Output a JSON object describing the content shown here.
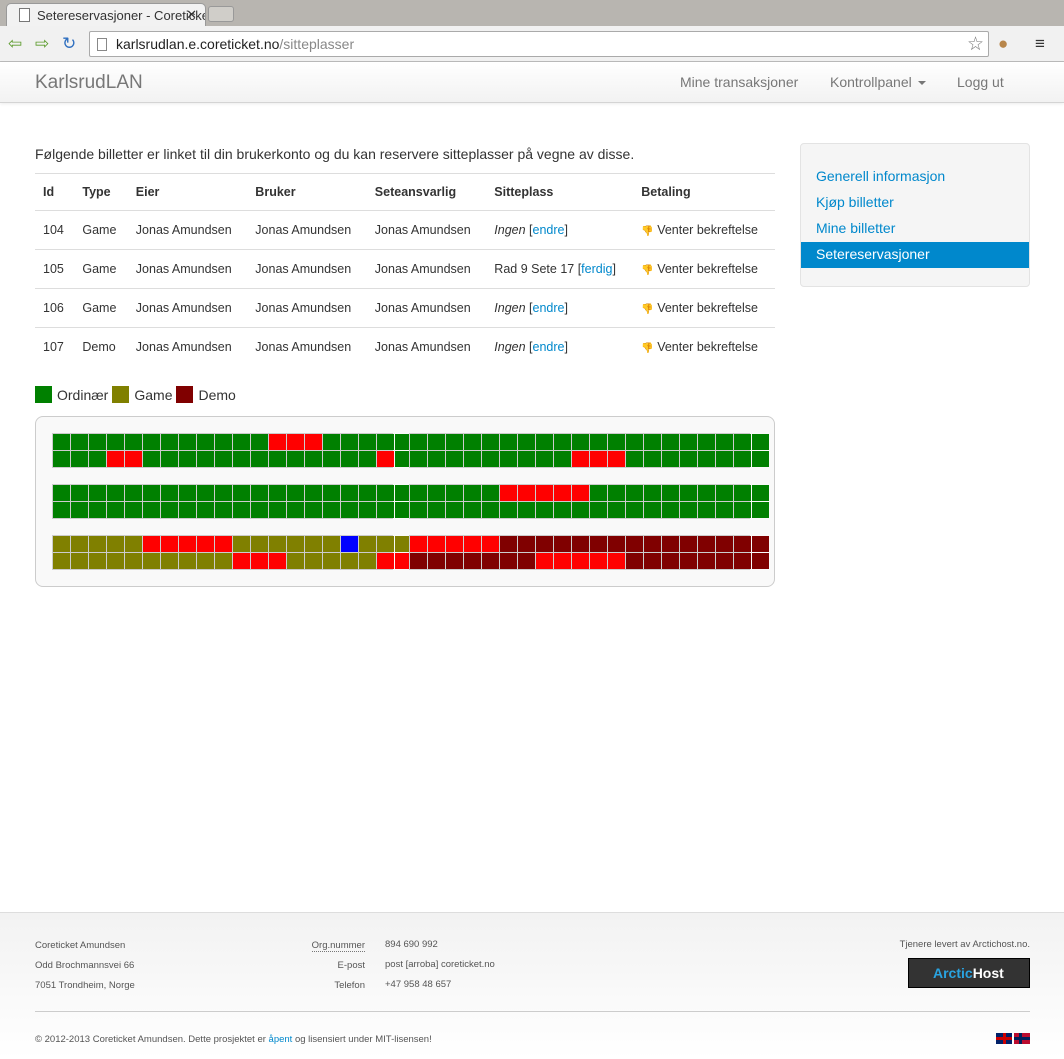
{
  "browser": {
    "tab_title": "Setereservasjoner - Coreticket",
    "url_host": "karlsrudlan.e.coreticket.no",
    "url_path": "/sitteplasser"
  },
  "navbar": {
    "brand": "KarlsrudLAN",
    "links": [
      "Mine transaksjoner",
      "Kontrollpanel",
      "Logg ut"
    ]
  },
  "intro": "Følgende billetter er linket til din brukerkonto og du kan reservere sitteplasser på vegne av disse.",
  "table": {
    "headers": [
      "Id",
      "Type",
      "Eier",
      "Bruker",
      "Seteansvarlig",
      "Sitteplass",
      "Betaling"
    ],
    "rows": [
      {
        "id": "104",
        "type": "Game",
        "eier": "Jonas Amundsen",
        "bruker": "Jonas Amundsen",
        "seteansvarlig": "Jonas Amundsen",
        "seat": "Ingen",
        "action": "endre",
        "payment": "Venter bekreftelse"
      },
      {
        "id": "105",
        "type": "Game",
        "eier": "Jonas Amundsen",
        "bruker": "Jonas Amundsen",
        "seteansvarlig": "Jonas Amundsen",
        "seat": "Rad 9 Sete 17",
        "action": "ferdig",
        "payment": "Venter bekreftelse"
      },
      {
        "id": "106",
        "type": "Game",
        "eier": "Jonas Amundsen",
        "bruker": "Jonas Amundsen",
        "seteansvarlig": "Jonas Amundsen",
        "seat": "Ingen",
        "action": "endre",
        "payment": "Venter bekreftelse"
      },
      {
        "id": "107",
        "type": "Demo",
        "eier": "Jonas Amundsen",
        "bruker": "Jonas Amundsen",
        "seteansvarlig": "Jonas Amundsen",
        "seat": "Ingen",
        "action": "endre",
        "payment": "Venter bekreftelse"
      }
    ]
  },
  "legend": [
    {
      "label": "Ordinær",
      "color": "#008000"
    },
    {
      "label": "Game",
      "color": "#808000"
    },
    {
      "label": "Demo",
      "color": "#800000"
    }
  ],
  "seatmap": {
    "key": {
      "g": "ordinary free",
      "o": "game free",
      "d": "demo free",
      "r": "taken",
      "b": "selected"
    },
    "blocks": [
      [
        "ggggggggggggrrrggggg",
        "gggrrgggggggggggggrg"
      ],
      [
        "gggggggggggggggggggg",
        "gggggggggggggggggggg"
      ],
      [
        "gggggggggggggggggggg",
        "gggggggggrrrgggggggg"
      ],
      [
        "gggggrrrrrgggggggggg",
        "gggggggggggggggggggg"
      ],
      [
        "ooooorrrrroooooobooo",
        "oooooooooorrrooooorr"
      ],
      [
        "rrrrrddddddddddddddd",
        "dddddddrrrrrdddddddd"
      ]
    ]
  },
  "sidebar": {
    "items": [
      "Generell informasjon",
      "Kjøp billetter",
      "Mine billetter",
      "Setereservasjoner"
    ],
    "active": 3
  },
  "footer": {
    "company": "Coreticket Amundsen",
    "address": "Odd Brochmannsvei 66",
    "city": "7051 Trondheim, Norge",
    "org_label": "Org.nummer",
    "org": "894 690 992",
    "email_label": "E-post",
    "email": "post [arroba] coreticket.no",
    "phone_label": "Telefon",
    "phone": "+47 958 48 657",
    "hosting": "Tjenere levert av Arctichost.no.",
    "host_logo_a": "Arctic",
    "host_logo_b": "Host",
    "copy_a": "© 2012-2013 Coreticket Amundsen. Dette prosjektet er ",
    "copy_link": "åpent",
    "copy_b": " og lisensiert under MIT-lisensen!"
  }
}
